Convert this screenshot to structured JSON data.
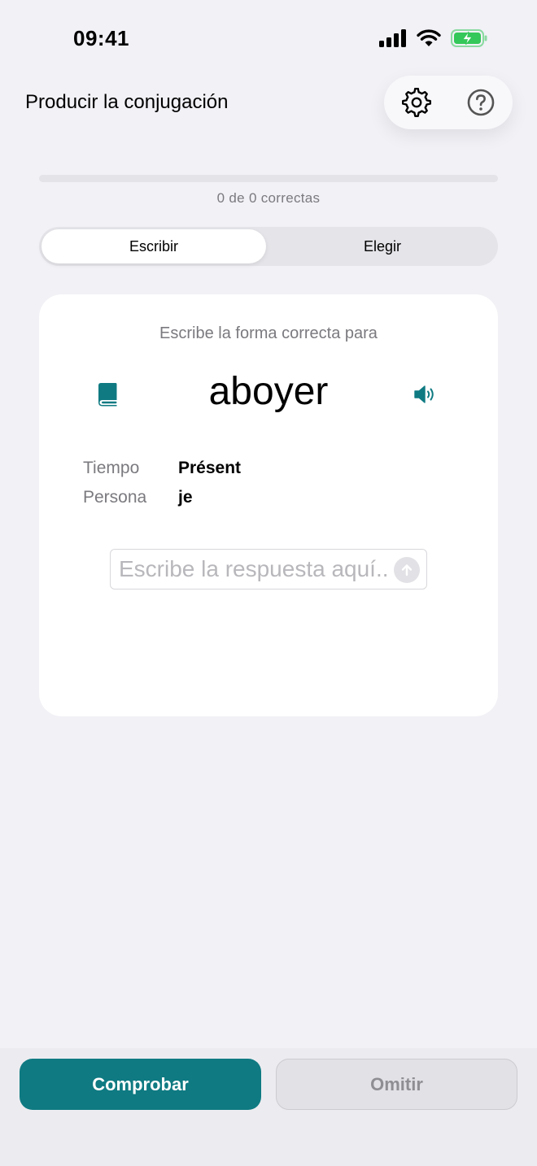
{
  "status_bar": {
    "time": "09:41"
  },
  "header": {
    "title": "Producir la conjugación",
    "icons": [
      "gear-icon",
      "question-circle-icon"
    ]
  },
  "progress": {
    "correct": 0,
    "total": 0,
    "fraction": 0,
    "text": "0 de 0 correctas"
  },
  "modes": {
    "write_label": "Escribir",
    "choose_label": "Elegir",
    "selected": "Escribir"
  },
  "card": {
    "prompt": "Escribe la forma correcta para",
    "verb": "aboyer",
    "tense_label": "Tiempo",
    "tense_value": "Présent",
    "person_label": "Persona",
    "person_value": "je",
    "answer_value": "",
    "answer_placeholder": "Escribe la respuesta aquí..."
  },
  "actions": {
    "check_label": "Comprobar",
    "skip_label": "Omitir"
  },
  "colors": {
    "accent": "#0F7A82",
    "battery": "#34C759",
    "background": "#F1F1F6"
  }
}
